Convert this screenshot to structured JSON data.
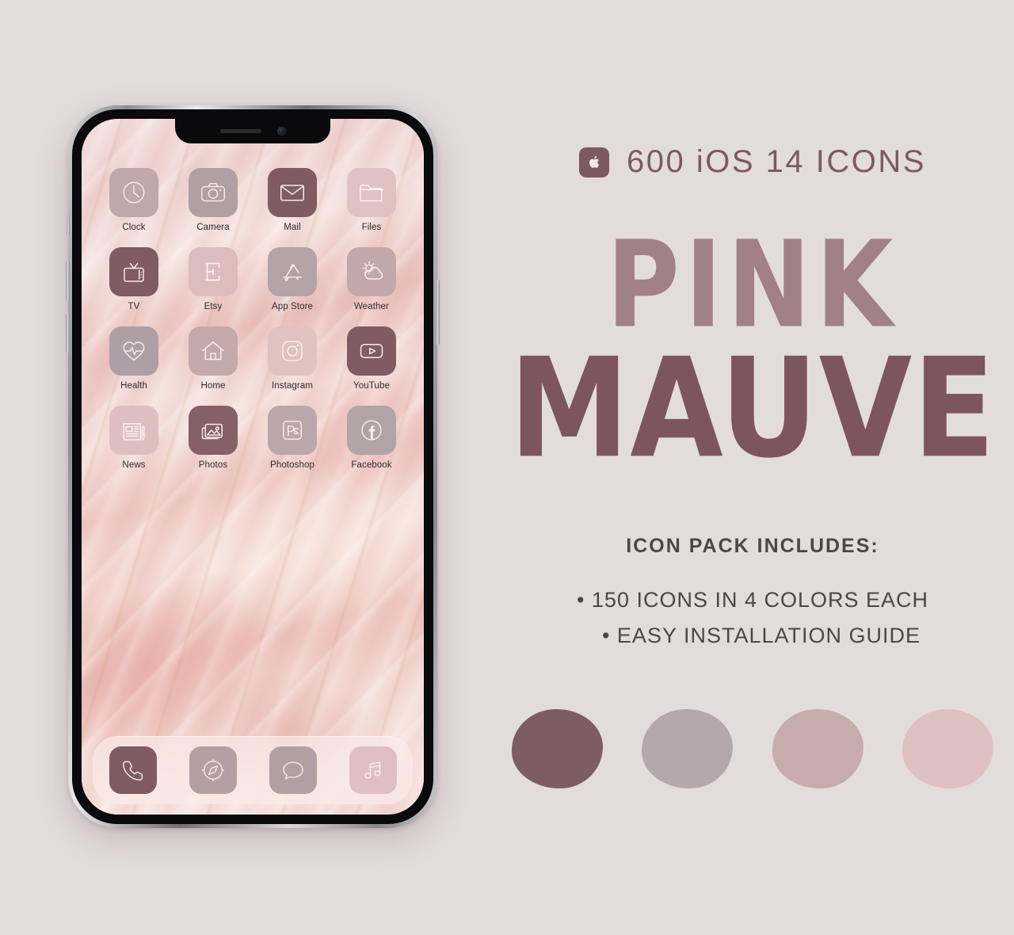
{
  "background_color": "#e3dcdc",
  "phone": {
    "device_name": "iphone-12-mockup",
    "wallpaper_name": "pink-marble-wallpaper",
    "home_screen": {
      "apps": [
        {
          "label": "Clock",
          "icon": "clock-icon",
          "tile_color": "#c0a7a8",
          "glyph_color": "#f7e9e6"
        },
        {
          "label": "Camera",
          "icon": "camera-icon",
          "tile_color": "#b0a0a4",
          "glyph_color": "#f7e9e6"
        },
        {
          "label": "Mail",
          "icon": "mail-icon",
          "tile_color": "#7e5c62",
          "glyph_color": "#f7e9e6"
        },
        {
          "label": "Files",
          "icon": "folder-icon",
          "tile_color": "#e0c2c2",
          "glyph_color": "#fbf1ee"
        },
        {
          "label": "TV",
          "icon": "tv-icon",
          "tile_color": "#7e5c62",
          "glyph_color": "#f7e9e6"
        },
        {
          "label": "Etsy",
          "icon": "etsy-icon",
          "tile_color": "#dcbcbc",
          "glyph_color": "#fbf1ee"
        },
        {
          "label": "App Store",
          "icon": "app-store-icon",
          "tile_color": "#b3a3a6",
          "glyph_color": "#f7e9e6"
        },
        {
          "label": "Weather",
          "icon": "weather-icon",
          "tile_color": "#c3a8a9",
          "glyph_color": "#f9ece9"
        },
        {
          "label": "Health",
          "icon": "health-icon",
          "tile_color": "#ad9fa5",
          "glyph_color": "#f7e9e6"
        },
        {
          "label": "Home",
          "icon": "home-icon",
          "tile_color": "#c3a9aa",
          "glyph_color": "#f9ece9"
        },
        {
          "label": "Instagram",
          "icon": "instagram-icon",
          "tile_color": "#e0c2c1",
          "glyph_color": "#fbf1ee"
        },
        {
          "label": "YouTube",
          "icon": "youtube-icon",
          "tile_color": "#7e5c62",
          "glyph_color": "#f7e9e6"
        },
        {
          "label": "News",
          "icon": "news-icon",
          "tile_color": "#ddbfbf",
          "glyph_color": "#fbf1ee"
        },
        {
          "label": "Photos",
          "icon": "photos-icon",
          "tile_color": "#856067",
          "glyph_color": "#f7e9e6"
        },
        {
          "label": "Photoshop",
          "icon": "photoshop-icon",
          "tile_color": "#bba7a9",
          "glyph_color": "#f7e9e6"
        },
        {
          "label": "Facebook",
          "icon": "facebook-icon",
          "tile_color": "#b1a3a6",
          "glyph_color": "#f7e9e6"
        }
      ]
    },
    "dock": {
      "apps": [
        {
          "label": "Phone",
          "icon": "phone-icon",
          "tile_color": "#7e5c62",
          "glyph_color": "#f7e9e6"
        },
        {
          "label": "Safari",
          "icon": "compass-icon",
          "tile_color": "#b3a0a3",
          "glyph_color": "#f7e9e6"
        },
        {
          "label": "Messages",
          "icon": "message-icon",
          "tile_color": "#b0a0a4",
          "glyph_color": "#f7e9e6"
        },
        {
          "label": "Music",
          "icon": "music-icon",
          "tile_color": "#e0bfc0",
          "glyph_color": "#fbf1ee"
        }
      ]
    }
  },
  "promo": {
    "header": {
      "icon": "apple-logo-icon",
      "text": "600 iOS 14 ICONS",
      "color": "#7b5a60"
    },
    "brand": {
      "line1": "PINK",
      "line2": "MAUVE",
      "line1_color": "#a18088",
      "line2_color": "#7c5560"
    },
    "includes_title": "ICON PACK INCLUDES:",
    "bullets": [
      "• 150 ICONS IN 4 COLORS EACH",
      "• EASY INSTALLATION GUIDE"
    ],
    "text_color": "#4e4546",
    "swatches": [
      {
        "name": "swatch-dark-mauve",
        "color": "#7e5c64"
      },
      {
        "name": "swatch-grey-mauve",
        "color": "#b5a8ad"
      },
      {
        "name": "swatch-dusty-pink",
        "color": "#c6acad"
      },
      {
        "name": "swatch-light-pink",
        "color": "#e0c1c2"
      }
    ]
  }
}
